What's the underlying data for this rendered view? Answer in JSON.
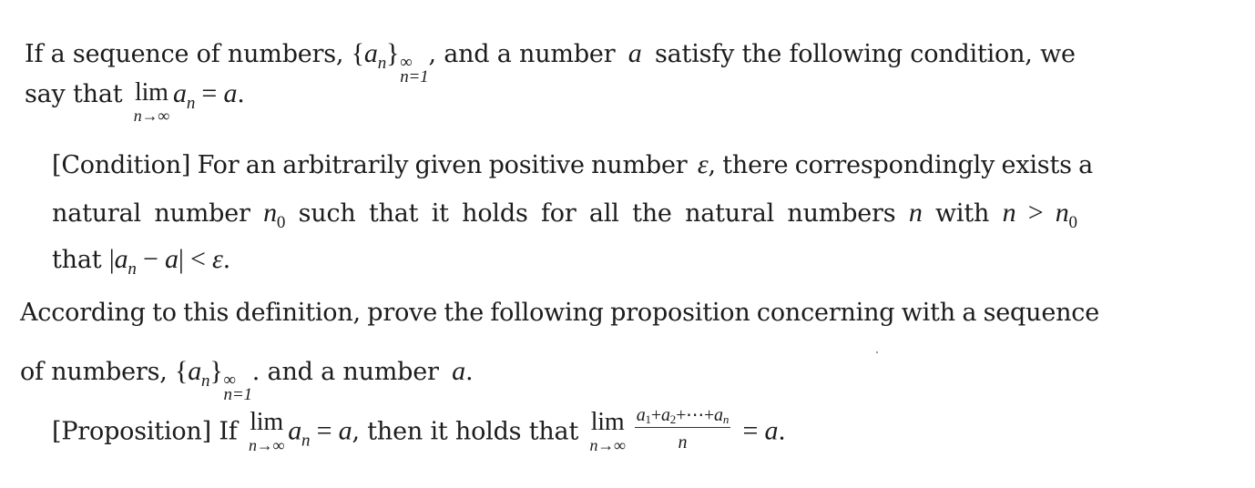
{
  "document": {
    "paragraph1": {
      "line1": {
        "t1": "If a sequence of numbers, ",
        "set_open": "{",
        "a": "a",
        "n": "n",
        "set_close": "}",
        "sup": "∞",
        "sub": "n=1",
        "t2": ", and a number ",
        "var_a": "a",
        "t3": " satisfy the following condition, we"
      },
      "line2": {
        "t1": "say that ",
        "lim": "lim",
        "lim_under": "n→∞",
        "a": "a",
        "n": "n",
        "eq": " = ",
        "rhs": "a",
        "end": "."
      }
    },
    "condition": {
      "line1": {
        "t1": "[Condition] For an arbitrarily given positive number ",
        "eps": "ε",
        "t2": ", there correspondingly exists a"
      },
      "line2": {
        "t1": "natural number ",
        "n": "n",
        "zero": "0",
        "t2": " such that it holds for all the natural numbers ",
        "n2": "n",
        "t3": " with ",
        "n3": "n",
        "gt": " > ",
        "n4": "n",
        "zero2": "0"
      },
      "line3": {
        "t1": "that ",
        "bar1": "|",
        "a": "a",
        "n": "n",
        "minus": " − ",
        "a2": "a",
        "bar2": "|",
        "lt": " < ",
        "eps": "ε",
        "end": "."
      }
    },
    "paragraph2": {
      "line1": {
        "t1": "According to this definition, prove the following proposition concerning with a sequence"
      },
      "line2": {
        "t1": "of numbers, ",
        "set_open": "{",
        "a": "a",
        "n": "n",
        "set_close": "}",
        "sup": "∞",
        "sub": "n=1",
        "t2": ". and a number ",
        "var_a": "a",
        "end": "."
      }
    },
    "proposition": {
      "t1": "[Proposition] If ",
      "lim": "lim",
      "lim_under": "n→∞",
      "a": "a",
      "n": "n",
      "eq": " = ",
      "rhs": "a",
      "t2": ", then it holds that ",
      "lim2": "lim",
      "lim2_under": "n→∞",
      "num_a1": "a",
      "num_s1": "1",
      "num_plus1": "+",
      "num_a2": "a",
      "num_s2": "2",
      "num_plus2": "+⋯+",
      "num_an": "a",
      "num_sn": "n",
      "den": "n",
      "eq2": " = ",
      "rhs2": "a",
      "end": "."
    }
  }
}
